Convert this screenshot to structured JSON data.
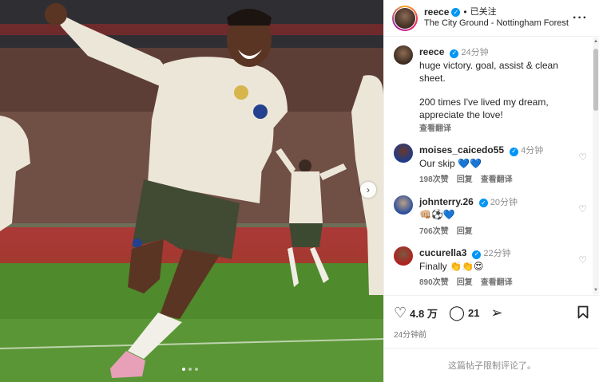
{
  "post": {
    "username": "reece",
    "follow_state": "已关注",
    "separator": "•",
    "location": "The City Ground - Nottingham Forest",
    "more_icon": "more-horizontal-icon"
  },
  "caption": {
    "username": "reece",
    "time": "24分钟",
    "lines": [
      "huge victory. goal, assist & clean sheet.",
      "200 times I've lived my dream, appreciate the love!"
    ],
    "translate": "查看翻译"
  },
  "comments": [
    {
      "username": "moises_caicedo55",
      "time": "4分钟",
      "text": "Our skip",
      "emoji": "💙💙",
      "likes": "198次赞",
      "reply": "回复",
      "translate": "查看翻译"
    },
    {
      "username": "johnterry.26",
      "time": "20分钟",
      "text": "",
      "emoji": "👊🏼⚽💙",
      "likes": "706次赞",
      "reply": "回复",
      "translate": ""
    },
    {
      "username": "cucurella3",
      "time": "22分钟",
      "text": "Finally",
      "emoji": "👏👏😍",
      "likes": "890次赞",
      "reply": "回复",
      "translate": "查看翻译"
    }
  ],
  "actions": {
    "likes_count": "4.8 万",
    "comments_count": "21",
    "posted_time": "24分钟前"
  },
  "comment_bar": {
    "text": "这篇帖子限制评论了。"
  },
  "colors": {
    "verified": "#0095f6",
    "muted": "#8e8e8e",
    "text": "#262626"
  }
}
